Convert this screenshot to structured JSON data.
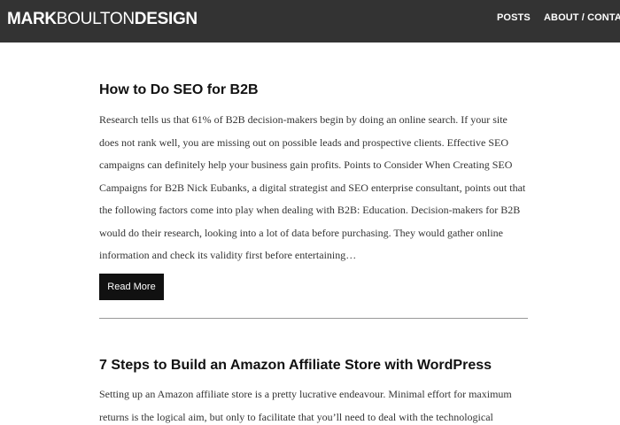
{
  "header": {
    "logo": {
      "part1": "MARK",
      "part2": "BOULTON",
      "part3": "DESIGN"
    },
    "nav": {
      "posts": "POSTS",
      "about_contact": "ABOUT / CONTACT"
    },
    "background_color": "#333333"
  },
  "posts": [
    {
      "title": "How to Do SEO for B2B",
      "excerpt": "Research tells us that 61% of B2B decision-makers begin by doing an online search. If your site does not rank well, you are missing out on possible leads and prospective clients. Effective SEO campaigns can definitely help your business gain profits.  Points to Consider When Creating SEO Campaigns for B2B Nick Eubanks, a digital strategist and SEO enterprise consultant, points out that the following factors come into play when dealing with B2B:  Education. Decision-makers for B2B would do their research, looking into a lot of data before purchasing. They would gather online information and check its validity first before entertaining…",
      "read_more": "Read More"
    },
    {
      "title": "7 Steps to Build an Amazon Affiliate Store with WordPress",
      "excerpt": "Setting up an Amazon affiliate store is a pretty lucrative endeavour. Minimal effort for maximum returns is the logical aim, but only to facilitate that you’ll need to deal with the technological"
    }
  ]
}
